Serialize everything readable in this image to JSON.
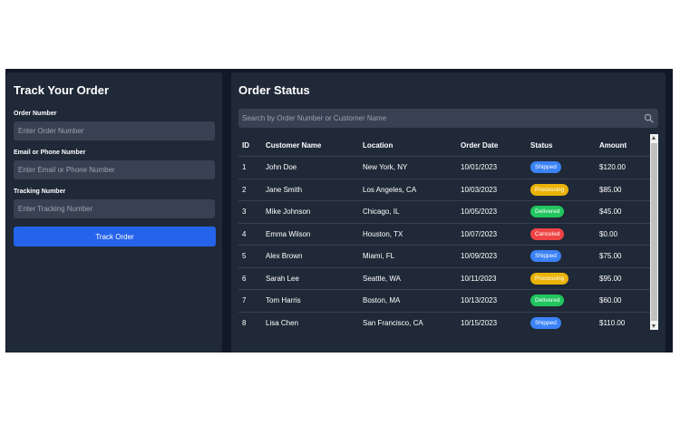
{
  "track_panel": {
    "title": "Track Your Order",
    "order_number_label": "Order Number",
    "order_number_placeholder": "Enter Order Number",
    "order_number_value": "",
    "email_label": "Email or Phone Number",
    "email_placeholder": "Enter Email or Phone Number",
    "email_value": "",
    "tracking_label": "Tracking Number",
    "tracking_placeholder": "Enter Tracking Number",
    "tracking_value": "",
    "button_label": "Track Order"
  },
  "status_panel": {
    "title": "Order Status",
    "search_placeholder": "Search by Order Number or Customer Name",
    "search_value": "",
    "search_icon": "search-icon",
    "columns": [
      "ID",
      "Customer Name",
      "Location",
      "Order Date",
      "Status",
      "Amount"
    ],
    "rows": [
      {
        "id": "1",
        "customer": "John Doe",
        "location": "New York, NY",
        "date": "10/01/2023",
        "status": "Shipped",
        "amount": "$120.00"
      },
      {
        "id": "2",
        "customer": "Jane Smith",
        "location": "Los Angeles, CA",
        "date": "10/03/2023",
        "status": "Processing",
        "amount": "$85.00"
      },
      {
        "id": "3",
        "customer": "Mike Johnson",
        "location": "Chicago, IL",
        "date": "10/05/2023",
        "status": "Delivered",
        "amount": "$45.00"
      },
      {
        "id": "4",
        "customer": "Emma Wilson",
        "location": "Houston, TX",
        "date": "10/07/2023",
        "status": "Canceled",
        "amount": "$0.00"
      },
      {
        "id": "5",
        "customer": "Alex Brown",
        "location": "Miami, FL",
        "date": "10/09/2023",
        "status": "Shipped",
        "amount": "$75.00"
      },
      {
        "id": "6",
        "customer": "Sarah Lee",
        "location": "Seattle, WA",
        "date": "10/11/2023",
        "status": "Processing",
        "amount": "$95.00"
      },
      {
        "id": "7",
        "customer": "Tom Harris",
        "location": "Boston, MA",
        "date": "10/13/2023",
        "status": "Delivered",
        "amount": "$60.00"
      },
      {
        "id": "8",
        "customer": "Lisa Chen",
        "location": "San Francisco, CA",
        "date": "10/15/2023",
        "status": "Shipped",
        "amount": "$110.00"
      }
    ]
  },
  "colors": {
    "page_background": "#111827",
    "panel_background": "#1f2937",
    "input_background": "#374151",
    "primary_button": "#2563eb",
    "status_shipped": "#3b82f6",
    "status_processing": "#eab308",
    "status_delivered": "#22c55e",
    "status_canceled": "#ef4444"
  }
}
